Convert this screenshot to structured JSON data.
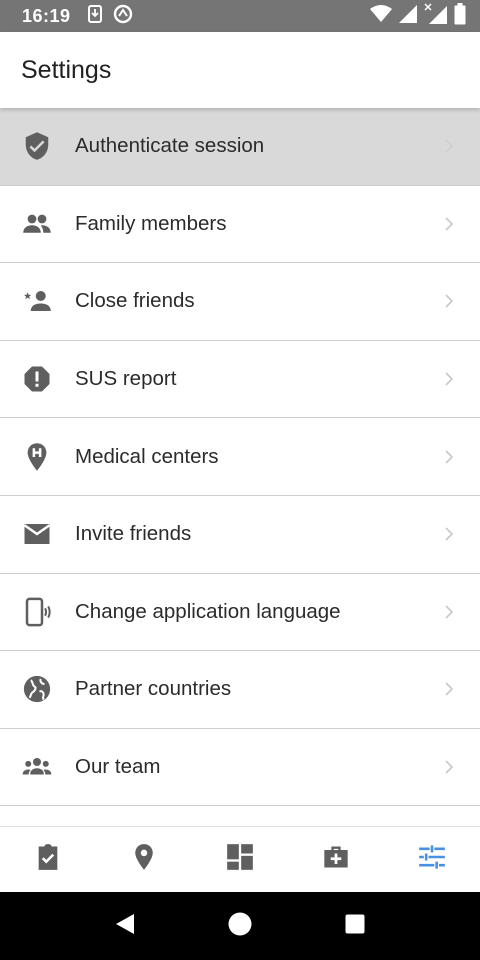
{
  "status_bar": {
    "time": "16:19"
  },
  "header": {
    "title": "Settings"
  },
  "settings": {
    "items": [
      {
        "label": "Authenticate session",
        "icon": "shield-check-icon",
        "pressed": true
      },
      {
        "label": "Family members",
        "icon": "people-icon"
      },
      {
        "label": "Close friends",
        "icon": "star-person-icon"
      },
      {
        "label": "SUS report",
        "icon": "report-alert-icon"
      },
      {
        "label": "Medical centers",
        "icon": "hospital-pin-icon"
      },
      {
        "label": "Invite friends",
        "icon": "mail-icon"
      },
      {
        "label": "Change application language",
        "icon": "phone-vibrate-icon"
      },
      {
        "label": "Partner countries",
        "icon": "globe-icon"
      },
      {
        "label": "Our team",
        "icon": "group-icon"
      }
    ]
  },
  "bottom_nav": {
    "items": [
      {
        "icon": "checklist-icon",
        "active": false
      },
      {
        "icon": "location-pin-icon",
        "active": false
      },
      {
        "icon": "dashboard-icon",
        "active": false
      },
      {
        "icon": "medical-bag-icon",
        "active": false
      },
      {
        "icon": "settings-sliders-icon",
        "active": true
      }
    ]
  },
  "colors": {
    "status_bar": "#757575",
    "icon_gray": "#5f5f5f",
    "active_blue": "#4a90e2",
    "pressed_bg": "#d9d9d9"
  }
}
